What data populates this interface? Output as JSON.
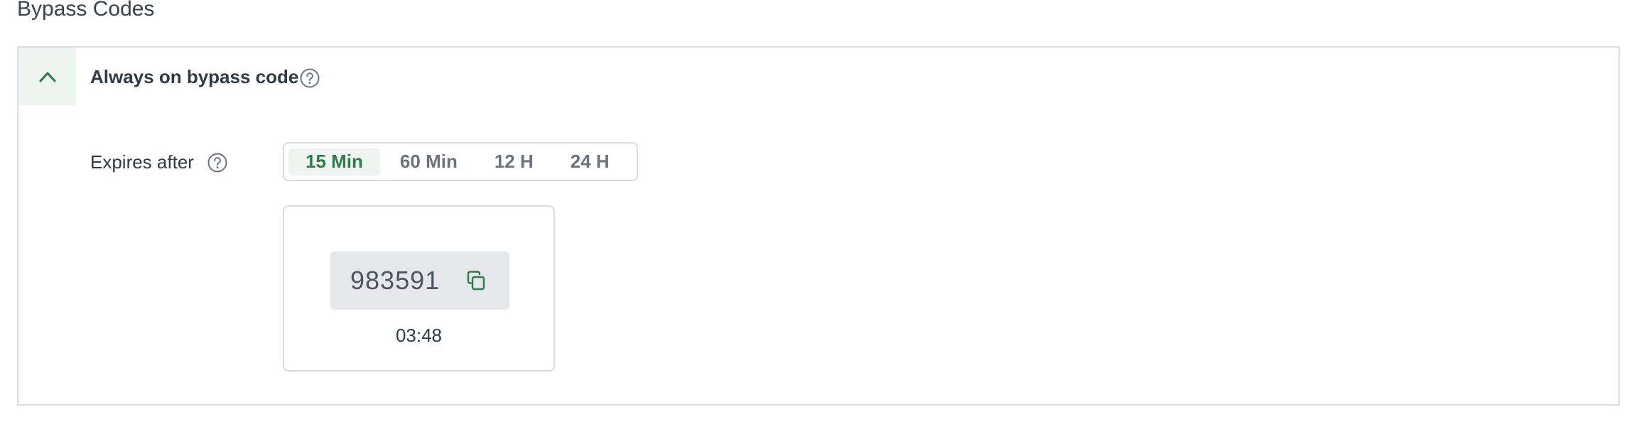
{
  "section": {
    "title": "Bypass Codes"
  },
  "panel": {
    "title": "Always on bypass code",
    "toggle_icon": "chevron-up-icon",
    "help_icon": "question-circle-icon"
  },
  "expires": {
    "label": "Expires after",
    "help_icon": "question-circle-icon",
    "options": [
      "15 Min",
      "60 Min",
      "12 H",
      "24 H"
    ],
    "selected": "15 Min"
  },
  "code": {
    "value": "983591",
    "copy_icon": "copy-icon",
    "timer": "03:48"
  },
  "colors": {
    "accent": "#2f7a4d",
    "accent_bg": "#eef4f0",
    "border": "#d8dbe0",
    "code_bg": "#e5e7ea"
  }
}
